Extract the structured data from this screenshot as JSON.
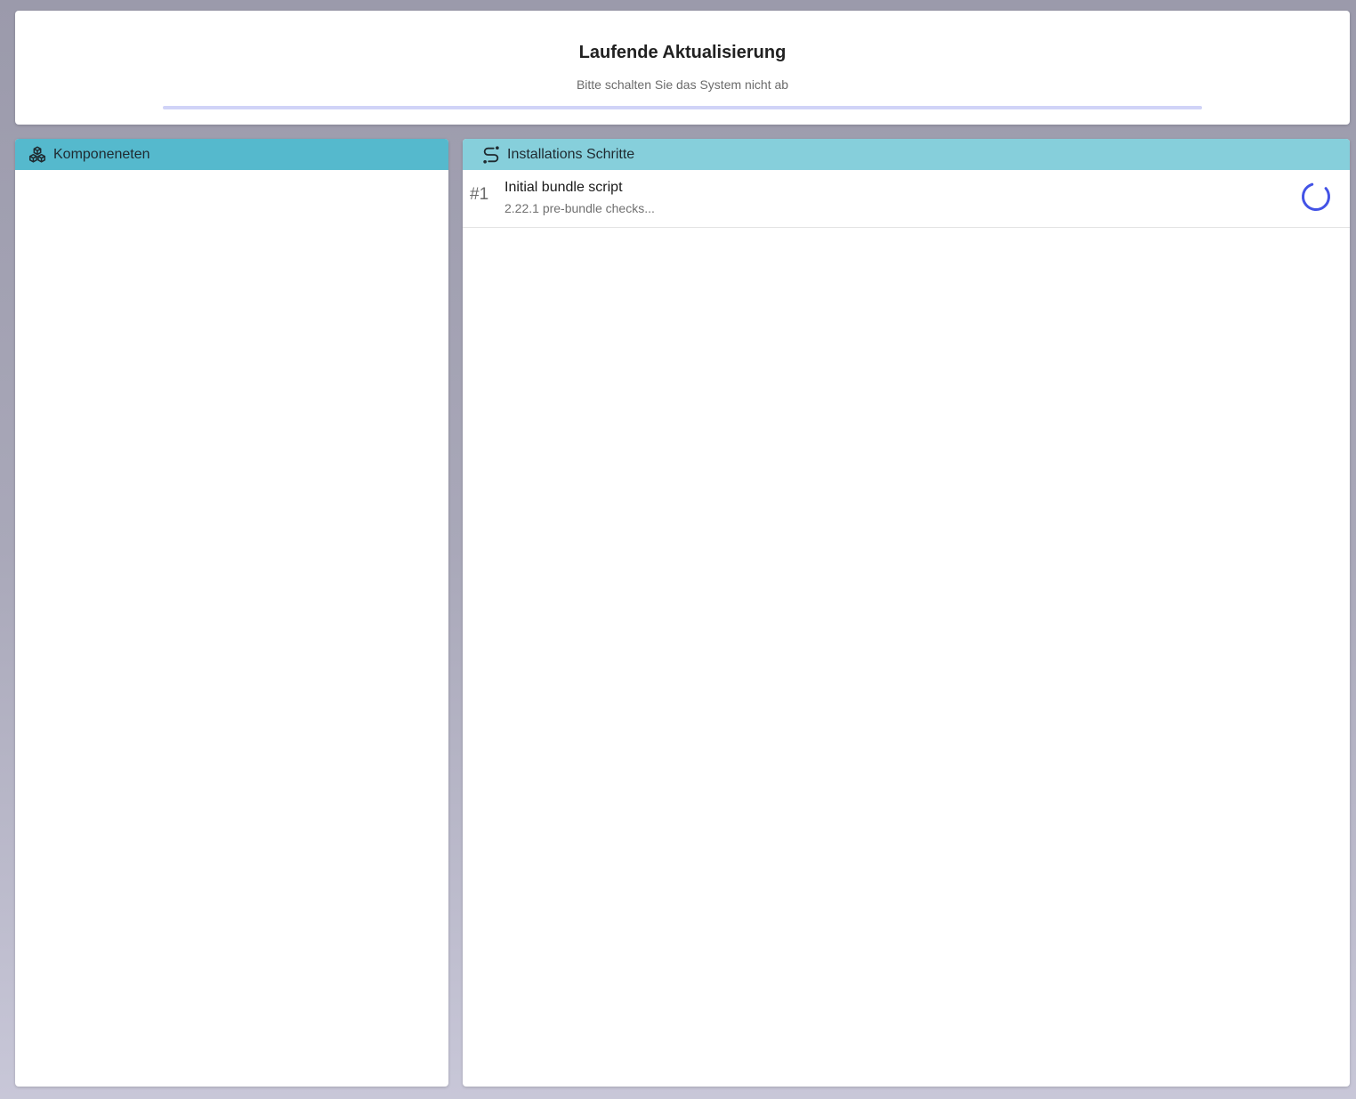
{
  "header": {
    "title": "Laufende Aktualisierung",
    "subtitle": "Bitte schalten Sie das System nicht ab",
    "progress_percent": 0,
    "colors": {
      "track": "#d0d3f7",
      "fill": "#5a63e8"
    }
  },
  "components_panel": {
    "title": "Komponeneten",
    "icon": "cubes-icon",
    "header_color": "#55b9cd",
    "items": []
  },
  "steps_panel": {
    "title": "Installations Schritte",
    "icon": "route-icon",
    "header_color": "#86cfdb",
    "steps": [
      {
        "number": "#1",
        "title": "Initial bundle script",
        "description": "2.22.1 pre-bundle checks...",
        "status_icon": "loading-spinner-icon",
        "spinner_color": "#4353e6"
      }
    ]
  }
}
